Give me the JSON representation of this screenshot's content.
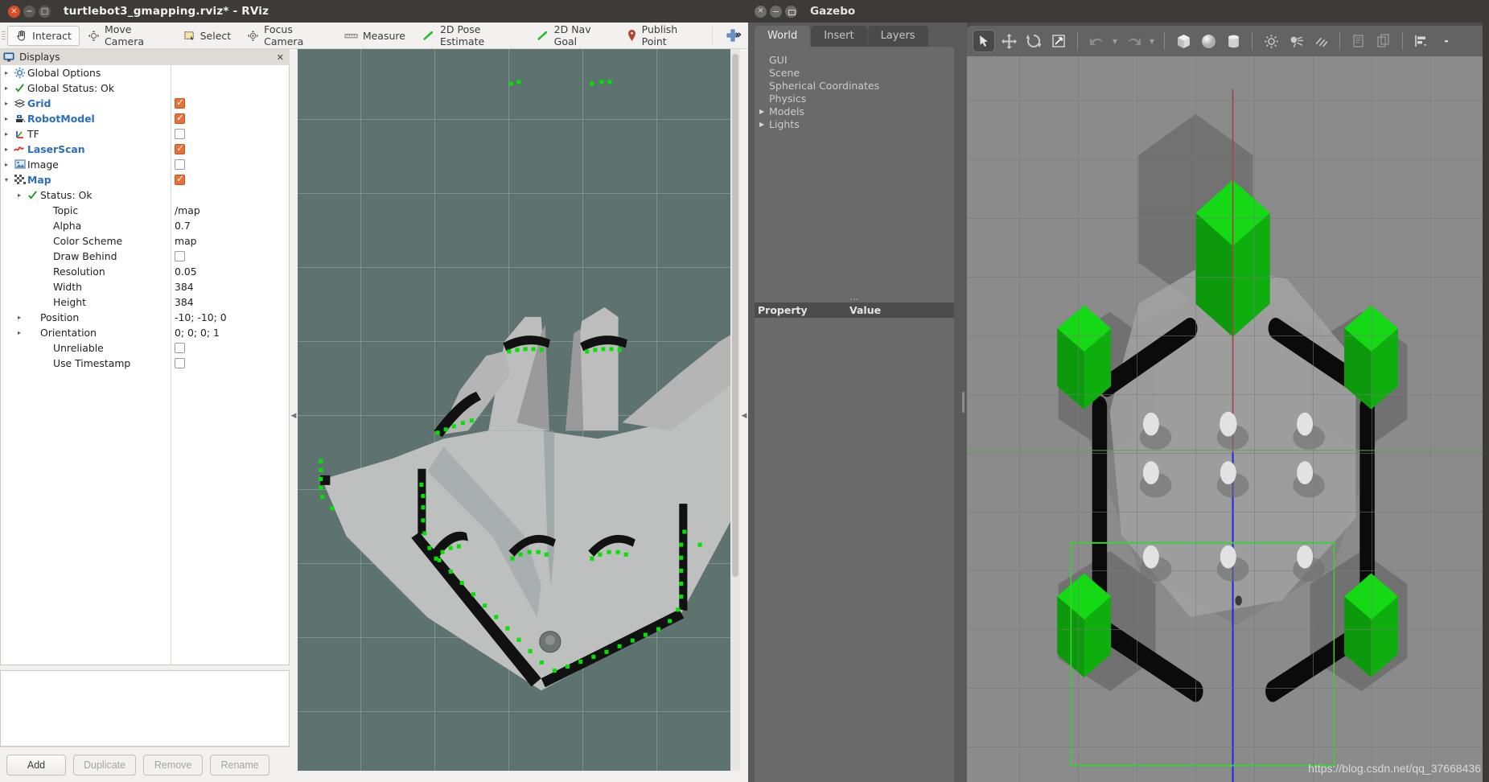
{
  "rviz": {
    "window_title": "turtlebot3_gmapping.rviz* - RViz",
    "toolbar": [
      {
        "label": "Interact",
        "icon": "hand-cursor-icon",
        "active": true
      },
      {
        "label": "Move Camera",
        "icon": "move-camera-icon",
        "active": false
      },
      {
        "label": "Select",
        "icon": "select-rect-icon",
        "active": false
      },
      {
        "label": "Focus Camera",
        "icon": "focus-camera-icon",
        "active": false
      },
      {
        "label": "Measure",
        "icon": "ruler-icon",
        "active": false
      },
      {
        "label": "2D Pose Estimate",
        "icon": "green-arrow-icon",
        "active": false
      },
      {
        "label": "2D Nav Goal",
        "icon": "green-arrow-icon",
        "active": false
      },
      {
        "label": "Publish Point",
        "icon": "map-pin-icon",
        "active": false
      }
    ],
    "toolbar_add_icon": "plus-icon",
    "toolbar_overflow": "»",
    "displays_panel": {
      "title": "Displays",
      "close_label": "✕",
      "tree": [
        {
          "label": "Global Options",
          "icon": "gear-icon",
          "arrow": "▸",
          "indent": 0,
          "bold": false,
          "value": "",
          "checkbox": null
        },
        {
          "label": "Global Status: Ok",
          "icon": "check-icon",
          "arrow": "▸",
          "indent": 0,
          "bold": false,
          "value": "",
          "checkbox": null
        },
        {
          "label": "Grid",
          "icon": "grid-icon",
          "arrow": "▸",
          "indent": 0,
          "bold": true,
          "value": "",
          "checkbox": true
        },
        {
          "label": "RobotModel",
          "icon": "robot-icon",
          "arrow": "▸",
          "indent": 0,
          "bold": true,
          "value": "",
          "checkbox": true
        },
        {
          "label": "TF",
          "icon": "tf-axes-icon",
          "arrow": "▸",
          "indent": 0,
          "bold": false,
          "value": "",
          "checkbox": false
        },
        {
          "label": "LaserScan",
          "icon": "laserscan-icon",
          "arrow": "▸",
          "indent": 0,
          "bold": true,
          "value": "",
          "checkbox": true
        },
        {
          "label": "Image",
          "icon": "image-icon",
          "arrow": "▸",
          "indent": 0,
          "bold": false,
          "value": "",
          "checkbox": false
        },
        {
          "label": "Map",
          "icon": "map-icon",
          "arrow": "▾",
          "indent": 0,
          "bold": true,
          "value": "",
          "checkbox": true
        },
        {
          "label": "Status: Ok",
          "icon": "check-icon",
          "arrow": "▸",
          "indent": 1,
          "bold": false,
          "value": "",
          "checkbox": null
        },
        {
          "label": "Topic",
          "icon": "",
          "arrow": "",
          "indent": 2,
          "bold": false,
          "value": "/map",
          "checkbox": null
        },
        {
          "label": "Alpha",
          "icon": "",
          "arrow": "",
          "indent": 2,
          "bold": false,
          "value": "0.7",
          "checkbox": null
        },
        {
          "label": "Color Scheme",
          "icon": "",
          "arrow": "",
          "indent": 2,
          "bold": false,
          "value": "map",
          "checkbox": null
        },
        {
          "label": "Draw Behind",
          "icon": "",
          "arrow": "",
          "indent": 2,
          "bold": false,
          "value": "",
          "checkbox": false
        },
        {
          "label": "Resolution",
          "icon": "",
          "arrow": "",
          "indent": 2,
          "bold": false,
          "value": "0.05",
          "checkbox": null
        },
        {
          "label": "Width",
          "icon": "",
          "arrow": "",
          "indent": 2,
          "bold": false,
          "value": "384",
          "checkbox": null
        },
        {
          "label": "Height",
          "icon": "",
          "arrow": "",
          "indent": 2,
          "bold": false,
          "value": "384",
          "checkbox": null
        },
        {
          "label": "Position",
          "icon": "",
          "arrow": "▸",
          "indent": 1,
          "bold": false,
          "value": "-10; -10; 0",
          "checkbox": null
        },
        {
          "label": "Orientation",
          "icon": "",
          "arrow": "▸",
          "indent": 1,
          "bold": false,
          "value": "0; 0; 0; 1",
          "checkbox": null
        },
        {
          "label": "Unreliable",
          "icon": "",
          "arrow": "",
          "indent": 2,
          "bold": false,
          "value": "",
          "checkbox": false
        },
        {
          "label": "Use Timestamp",
          "icon": "",
          "arrow": "",
          "indent": 2,
          "bold": false,
          "value": "",
          "checkbox": false
        }
      ],
      "buttons": [
        {
          "label": "Add",
          "enabled": true
        },
        {
          "label": "Duplicate",
          "enabled": false
        },
        {
          "label": "Remove",
          "enabled": false
        },
        {
          "label": "Rename",
          "enabled": false
        }
      ]
    },
    "view": {
      "background_color": "#5e7270",
      "occupied_color": "#000000",
      "free_color": "#c8c8c8",
      "laser_color": "#00ff00",
      "collapse_left_icon": "collapse-left-icon",
      "collapse_right_icon": "collapse-right-icon"
    }
  },
  "gazebo": {
    "window_title": "Gazebo",
    "tabs": [
      {
        "label": "World",
        "active": true
      },
      {
        "label": "Insert",
        "active": false
      },
      {
        "label": "Layers",
        "active": false
      }
    ],
    "world_tree": [
      {
        "label": "GUI",
        "arrow": ""
      },
      {
        "label": "Scene",
        "arrow": ""
      },
      {
        "label": "Spherical Coordinates",
        "arrow": ""
      },
      {
        "label": "Physics",
        "arrow": ""
      },
      {
        "label": "Models",
        "arrow": "▶"
      },
      {
        "label": "Lights",
        "arrow": "▶"
      }
    ],
    "property_header": {
      "property": "Property",
      "value": "Value"
    },
    "toolbar": [
      {
        "icon": "select-arrow-icon",
        "active": true
      },
      {
        "icon": "translate-icon",
        "active": false
      },
      {
        "icon": "rotate-icon",
        "active": false
      },
      {
        "icon": "scale-icon",
        "active": false
      },
      {
        "icon": "separator",
        "active": false
      },
      {
        "icon": "undo-icon",
        "active": false
      },
      {
        "icon": "caret-down-icon",
        "active": false
      },
      {
        "icon": "redo-icon",
        "active": false
      },
      {
        "icon": "caret-down-icon",
        "active": false
      },
      {
        "icon": "separator",
        "active": false
      },
      {
        "icon": "box-icon",
        "active": false
      },
      {
        "icon": "sphere-icon",
        "active": false
      },
      {
        "icon": "cylinder-icon",
        "active": false
      },
      {
        "icon": "separator",
        "active": false
      },
      {
        "icon": "point-light-icon",
        "active": false
      },
      {
        "icon": "spot-light-icon",
        "active": false
      },
      {
        "icon": "directional-light-icon",
        "active": false
      },
      {
        "icon": "separator",
        "active": false
      },
      {
        "icon": "copy-icon",
        "active": false
      },
      {
        "icon": "paste-icon",
        "active": false
      },
      {
        "icon": "separator",
        "active": false
      },
      {
        "icon": "align-icon",
        "active": false
      },
      {
        "icon": "more-dots-icon",
        "active": false
      }
    ],
    "scene": {
      "ground_color": "#8b8b8b",
      "wall_color": "#000000",
      "pillar_color": "#18b018",
      "marker_color": "#dcdcdc",
      "selection_box_color": "#33cc33",
      "axis_z_color": "#3333ff",
      "axis_x_color": "#aa4444"
    },
    "watermark": "https://blog.csdn.net/qq_37668436"
  }
}
